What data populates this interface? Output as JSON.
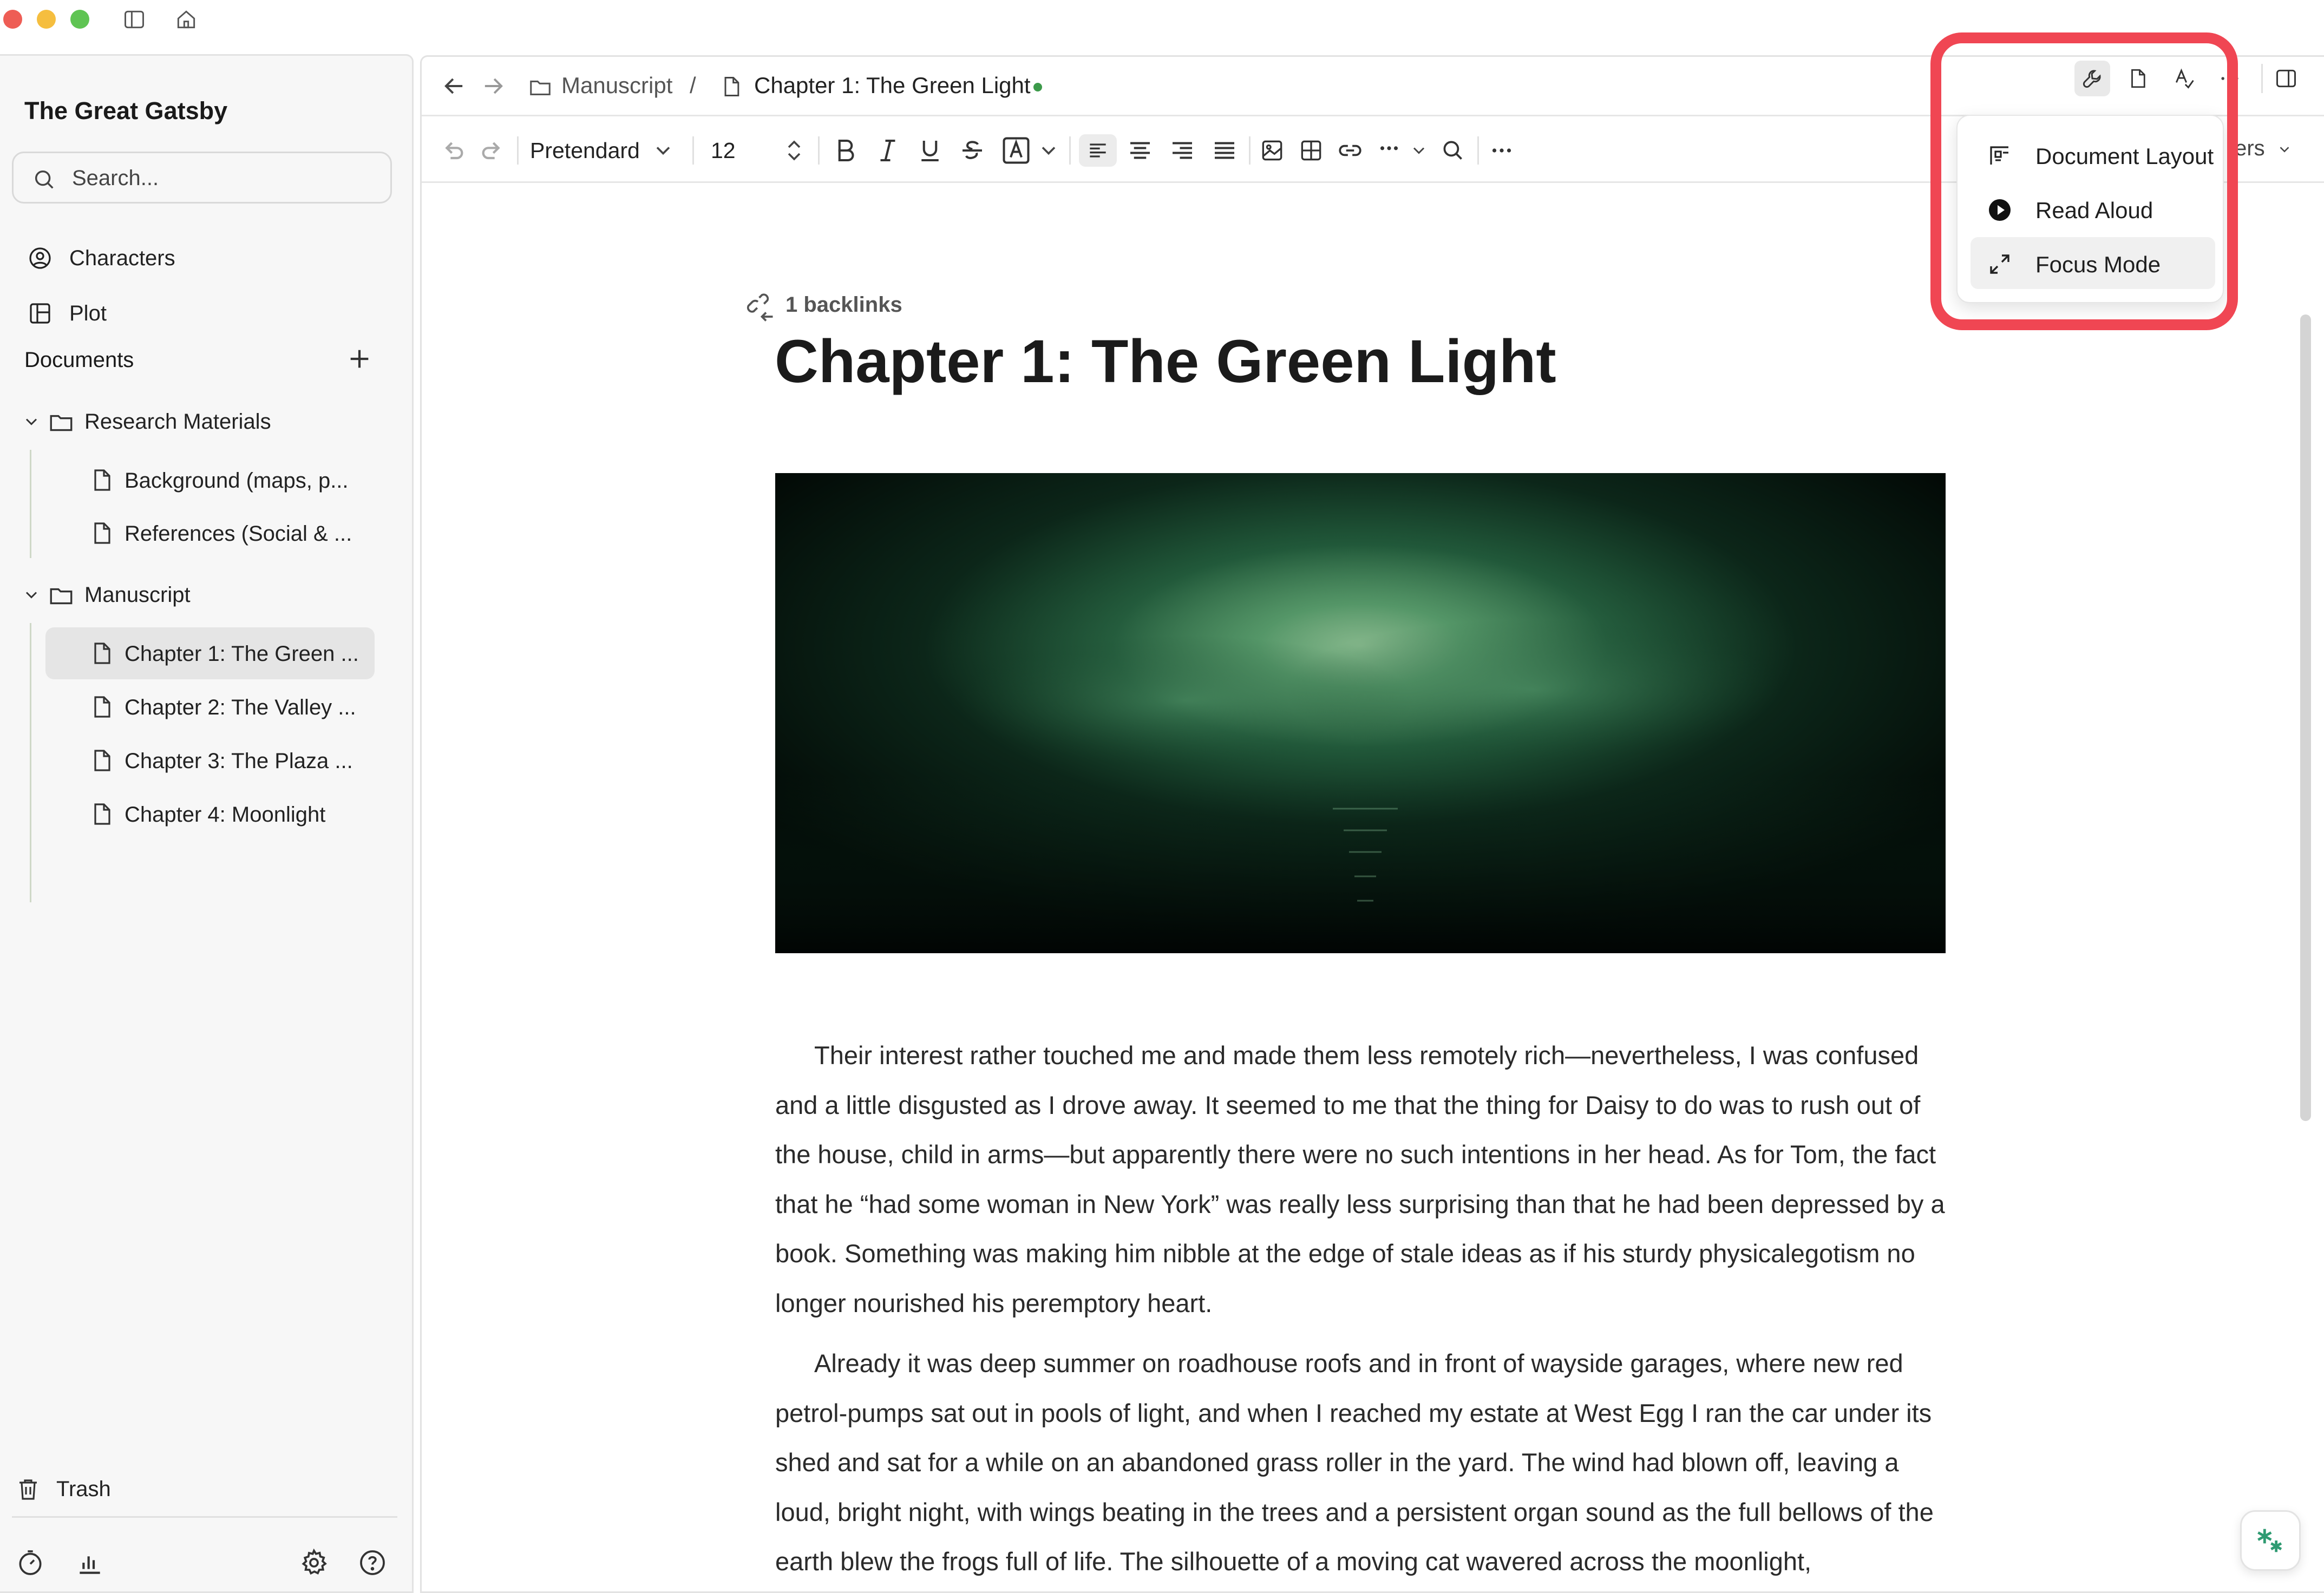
{
  "project": {
    "title": "The Great Gatsby"
  },
  "search": {
    "placeholder": "Search..."
  },
  "sidebar": {
    "top_items": [
      {
        "label": "Characters",
        "icon": "person-circle-icon"
      },
      {
        "label": "Plot",
        "icon": "board-icon"
      }
    ],
    "documents_header": "Documents",
    "folders": [
      {
        "label": "Research Materials",
        "expanded": true,
        "items": [
          {
            "label": "Background (maps, p..."
          },
          {
            "label": "References (Social & ..."
          }
        ]
      },
      {
        "label": "Manuscript",
        "expanded": true,
        "items": [
          {
            "label": "Chapter 1: The Green ...",
            "selected": true
          },
          {
            "label": "Chapter 2: The Valley ..."
          },
          {
            "label": "Chapter 3: The Plaza ..."
          },
          {
            "label": "Chapter 4: Moonlight"
          }
        ]
      }
    ],
    "trash_label": "Trash"
  },
  "breadcrumb": {
    "folder": "Manuscript",
    "separator": "/",
    "document": "Chapter 1: The Green Light"
  },
  "toolbar": {
    "font": "Pretendard",
    "size": "12",
    "filters_peek": "ters"
  },
  "menu": {
    "items": [
      {
        "label": "Document Layout",
        "icon": "layout-icon"
      },
      {
        "label": "Read Aloud",
        "icon": "play-circle-icon"
      },
      {
        "label": "Focus Mode",
        "icon": "expand-icon",
        "hovered": true
      }
    ]
  },
  "document": {
    "backlinks": "1 backlinks",
    "title": "Chapter 1: The Green Light",
    "paragraphs": [
      "Their interest rather touched me and made them less remotely rich—nevertheless, I was confused and a little disgusted as I drove away. It seemed to me that the thing for Daisy to do was to rush out of the house, child in arms—but apparently there were no such intentions in her head. As for Tom, the fact that he “had some woman in New York” was really less surprising than that he had been depressed by a book. Something was making him nibble at the edge of stale ideas as if his sturdy physicalegotism no longer nourished his peremptory heart.",
      "Already it was deep summer on roadhouse roofs and in front of wayside garages, where new red petrol-pumps sat out in pools of light, and when I reached my estate at West Egg I ran the car under its shed and sat for a while on an abandoned grass roller in the yard. The wind had blown off, leaving a loud, bright night, with wings beating in the trees and a persistent organ sound as the full bellows of the earth blew the frogs full of life. The silhouette of a moving cat wavered across the moonlight,"
    ]
  },
  "colors": {
    "accent_highlight": "#f04653",
    "status_dot": "#3c9a4a",
    "selected_row": "#e5e5e5"
  }
}
